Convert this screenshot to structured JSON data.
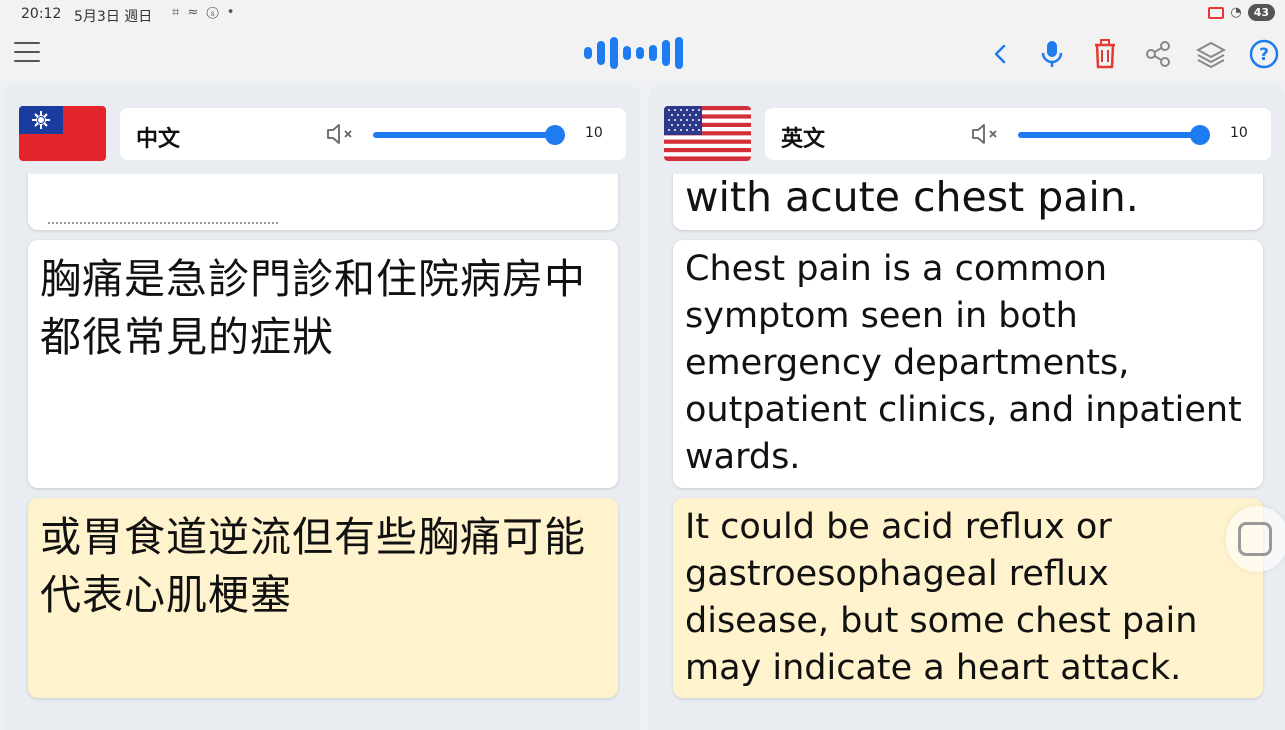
{
  "status": {
    "time": "20:12",
    "date": "5月3日 週日",
    "battery": "43"
  },
  "toolbar": {
    "menu_icon": "hamburger-menu-icon",
    "logo_icon": "audio-wave-logo",
    "back_icon": "chevron-left-icon",
    "mic_icon": "microphone-icon",
    "delete_icon": "trash-icon",
    "share_icon": "share-icon",
    "layers_icon": "layers-icon",
    "help_icon": "help-icon"
  },
  "colors": {
    "accent": "#1e7bf0",
    "delete": "#e53935",
    "active_card": "#fff3cd"
  },
  "left": {
    "flag": "taiwan-flag",
    "language": "中文",
    "volume": "10",
    "cards": [
      {
        "text": "胸痛是急診門診和住院病房中都很常見的症狀"
      },
      {
        "text": "或胃食道逆流但有些胸痛可能代表心肌梗塞"
      }
    ]
  },
  "right": {
    "flag": "usa-flag",
    "language": "英文",
    "volume": "10",
    "cards": [
      {
        "text": "with acute chest pain."
      },
      {
        "text": "Chest pain is a common symptom seen in both emergency departments, outpatient clinics, and inpatient wards."
      },
      {
        "text": "It could be acid reflux or gastroesophageal reflux disease, but some chest pain may indicate a heart attack."
      }
    ]
  }
}
